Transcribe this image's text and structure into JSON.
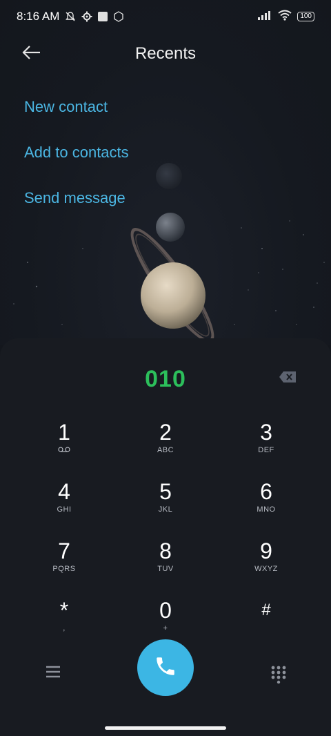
{
  "status_bar": {
    "time": "8:16 AM",
    "icons_left": [
      "muted-bell-icon",
      "gear-icon",
      "square-icon",
      "mi-icon"
    ],
    "icons_right": [
      "signal-icon",
      "wifi-icon",
      "battery-icon"
    ],
    "battery": "100"
  },
  "header": {
    "title": "Recents",
    "back_icon": "arrow-left-icon"
  },
  "actions": {
    "new_contact": "New contact",
    "add_to_contacts": "Add to contacts",
    "send_message": "Send message"
  },
  "dialer": {
    "number": "010",
    "keys": [
      {
        "digit": "1",
        "letters": "voicemail-icon"
      },
      {
        "digit": "2",
        "letters": "ABC"
      },
      {
        "digit": "3",
        "letters": "DEF"
      },
      {
        "digit": "4",
        "letters": "GHI"
      },
      {
        "digit": "5",
        "letters": "JKL"
      },
      {
        "digit": "6",
        "letters": "MNO"
      },
      {
        "digit": "7",
        "letters": "PQRS"
      },
      {
        "digit": "8",
        "letters": "TUV"
      },
      {
        "digit": "9",
        "letters": "WXYZ"
      },
      {
        "digit": "*",
        "letters": ","
      },
      {
        "digit": "0",
        "letters": "+"
      },
      {
        "digit": "#",
        "letters": ""
      }
    ]
  },
  "colors": {
    "accent": "#3cb6e4",
    "link": "#4bb6e3",
    "number": "#2cbf5b",
    "background": "#14171d"
  }
}
